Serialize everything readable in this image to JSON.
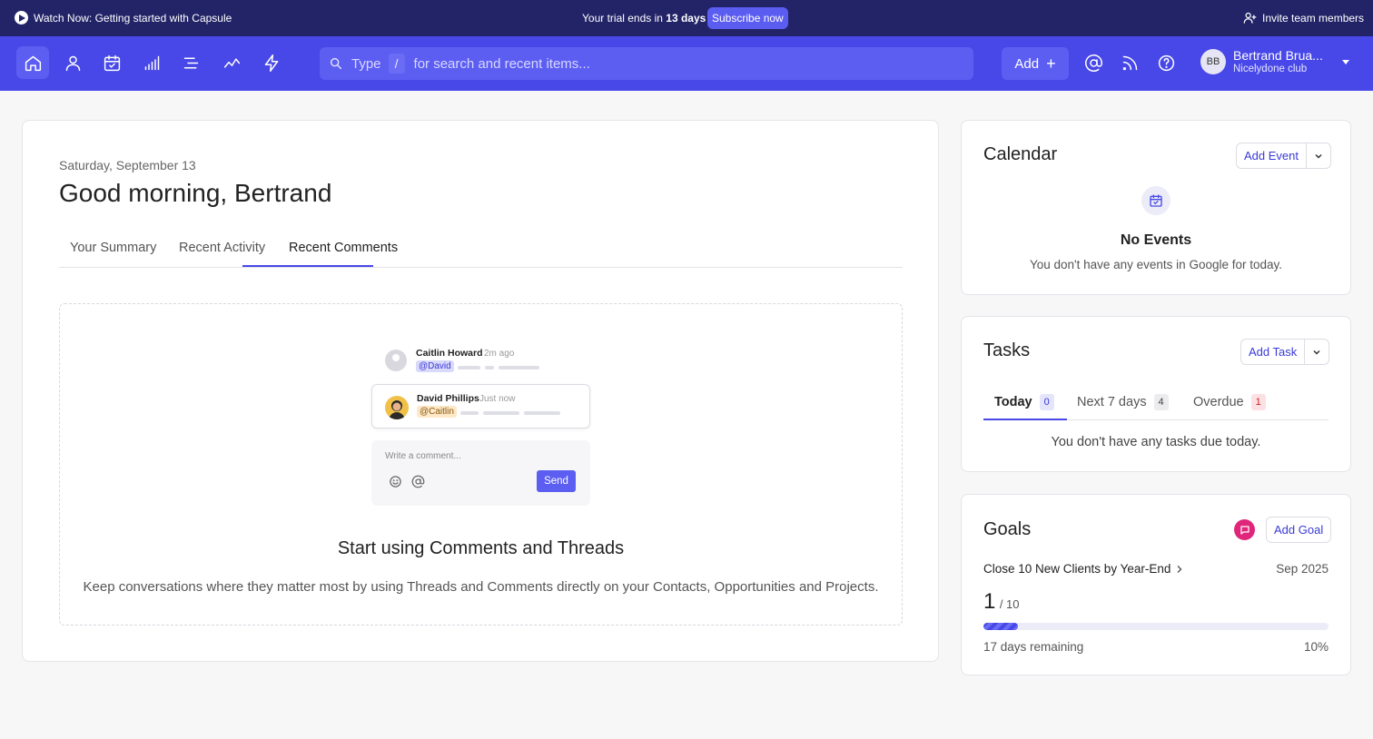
{
  "banner": {
    "watch_label": "Watch Now: Getting started with Capsule",
    "trial_prefix": "Your trial ends in ",
    "trial_days": "13 days",
    "subscribe_label": "Subscribe now",
    "invite_label": "Invite team members"
  },
  "nav": {
    "icons": [
      "home-icon",
      "contacts-icon",
      "calendar-icon",
      "pipeline-icon",
      "projects-icon",
      "reports-icon",
      "workflow-icon"
    ],
    "search_lead": "Type",
    "search_slash": "/",
    "search_rest": "for search and recent items...",
    "add_label": "Add",
    "add_symbol": "+",
    "user_initials": "BB",
    "user_name": "Bertrand Brua...",
    "user_org": "Nicelydone club"
  },
  "main": {
    "date": "Saturday, September 13",
    "greeting": "Good morning, Bertrand",
    "tabs": [
      {
        "label": "Your Summary"
      },
      {
        "label": "Recent Activity"
      },
      {
        "label": "Recent Comments"
      }
    ],
    "active_tab": "Recent Comments",
    "illustration": {
      "c1_name": "Caitlin Howard",
      "c1_time": "2m ago",
      "c1_mention": "@David",
      "c2_name": "David Phillips",
      "c2_time": "Just now",
      "c2_mention": "@Caitlin",
      "comment_placeholder": "Write a comment...",
      "send_label": "Send"
    },
    "empty_title": "Start using Comments and Threads",
    "empty_desc": "Keep conversations where they matter most by using Threads and Comments directly on your Contacts, Opportunities and Projects."
  },
  "calendar": {
    "title": "Calendar",
    "add_label": "Add Event",
    "empty_title": "No Events",
    "empty_desc": "You don't have any events in Google for today."
  },
  "tasks": {
    "title": "Tasks",
    "add_label": "Add Task",
    "tabs": [
      {
        "label": "Today",
        "count": "0"
      },
      {
        "label": "Next 7 days",
        "count": "4"
      },
      {
        "label": "Overdue",
        "count": "1"
      }
    ],
    "empty_desc": "You don't have any tasks due today."
  },
  "goals": {
    "title": "Goals",
    "add_label": "Add Goal",
    "goal_name": "Close 10 New Clients by Year-End",
    "goal_date": "Sep 2025",
    "current": "1",
    "target": "/ 10",
    "progress": 0.1,
    "remaining": "17 days remaining",
    "percent": "10%"
  },
  "colors": {
    "banner_bg": "#232468",
    "nav_bg": "#4848e8",
    "accent": "#5c5ef2",
    "goal_icon": "#e0267a"
  }
}
